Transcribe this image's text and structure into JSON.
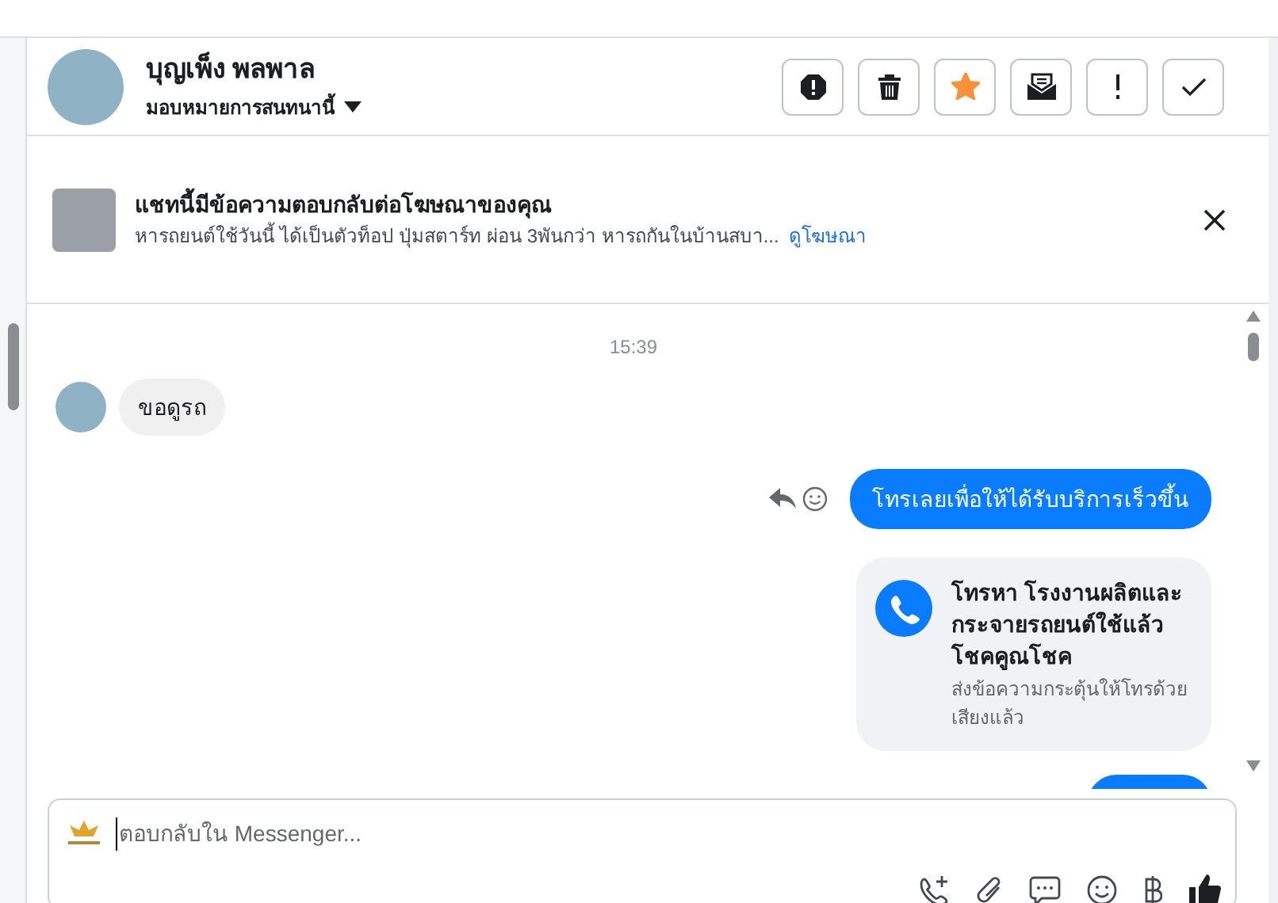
{
  "contact": {
    "name": "บุญเพ็ง พลพาล",
    "assign_label": "มอบหมายการสนทนานี้"
  },
  "actions": [
    {
      "kind": "spam"
    },
    {
      "kind": "delete"
    },
    {
      "kind": "star",
      "on": true
    },
    {
      "kind": "unread"
    },
    {
      "kind": "important"
    },
    {
      "kind": "done"
    }
  ],
  "ad_banner": {
    "title": "แชทนี้มีข้อความตอบกลับต่อโฆษณาของคุณ",
    "text": "หารถยนต์ใช้วันนี้ ได้เป็นตัวท็อป ปุ่มสตาร์ท ผ่อน 3พันกว่า หารถกันในบ้านสบา...",
    "link": "ดูโฆษณา"
  },
  "messages": [
    {
      "kind": "time",
      "text": "15:39"
    },
    {
      "kind": "incoming",
      "text": "ขอดูรถ"
    },
    {
      "kind": "outgoing",
      "text": "โทรเลยเพื่อให้ได้รับบริการเร็วขึ้น"
    },
    {
      "kind": "call_card",
      "title": "โทรหา โรงงานผลิตและกระจายรถยนต์ใช้แล้ว โชคคูณโชค",
      "subtitle": "ส่งข้อความกระตุ้นให้โทรด้วยเสียงแล้ว"
    },
    {
      "kind": "outgoing_cut"
    }
  ],
  "composer": {
    "placeholder": "ตอบกลับใน Messenger..."
  }
}
